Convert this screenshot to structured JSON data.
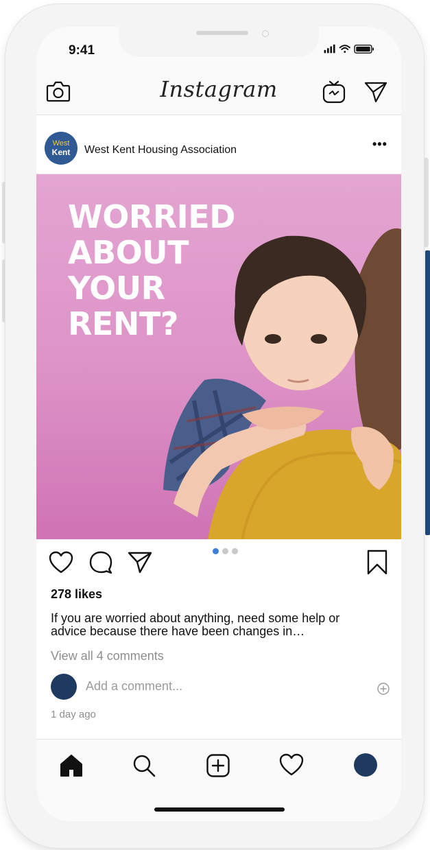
{
  "status_bar": {
    "time": "9:41"
  },
  "header": {
    "logo": "Instagram",
    "icons": [
      "camera-icon",
      "igtv-icon",
      "direct-message-icon"
    ]
  },
  "post": {
    "account_name": "West Kent Housing Association",
    "avatar_text": {
      "line1": "West",
      "line2": "Kent"
    },
    "more_label": "•••",
    "image_headline": [
      "WORRIED",
      "ABOUT",
      "YOUR",
      "RENT?"
    ],
    "carousel": {
      "count": 3,
      "active_index": 0
    },
    "likes": "278 likes",
    "caption": "If you are worried about anything, need some help or advice because there have been changes in…",
    "view_comments": "View all 4 comments",
    "comment_placeholder": "Add a comment...",
    "timestamp": "1 day ago"
  },
  "tabbar": {
    "items": [
      "home-icon",
      "search-icon",
      "new-post-icon",
      "activity-icon",
      "profile-icon"
    ]
  },
  "colors": {
    "avatar_blue": "#2f5a93",
    "profile_navy": "#1f3a60",
    "carousel_active": "#3d7fd6",
    "image_background": "#dd92c6"
  }
}
